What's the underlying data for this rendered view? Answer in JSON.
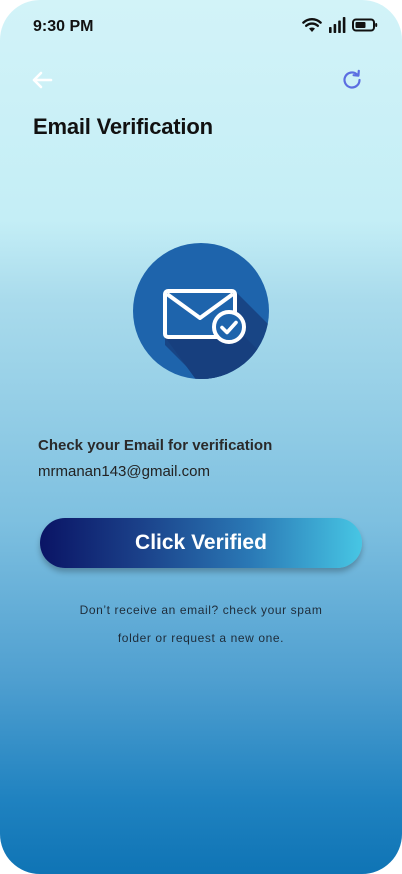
{
  "status_bar": {
    "time": "9:30 PM",
    "icons": [
      "wifi-icon",
      "signal-icon",
      "battery-icon"
    ]
  },
  "header": {
    "back_icon": "arrow-left-icon",
    "refresh_icon": "refresh-icon",
    "title": "Email Verification"
  },
  "illustration": {
    "icon": "mail-check-icon",
    "colors": {
      "circle": "#1e64ac",
      "shadow": "#173f7e",
      "envelope": "#ffffff"
    }
  },
  "verification": {
    "heading": "Check your Email for verification",
    "email": "mrmanan143@gmail.com"
  },
  "button": {
    "label": "Click Verified"
  },
  "helper": {
    "line1": "Don’t receive an email? check your spam",
    "line2": "folder or request a new one."
  },
  "colors": {
    "accent": "#5b6ee1",
    "button_start": "#0a1465",
    "button_end": "#47c6e4"
  }
}
